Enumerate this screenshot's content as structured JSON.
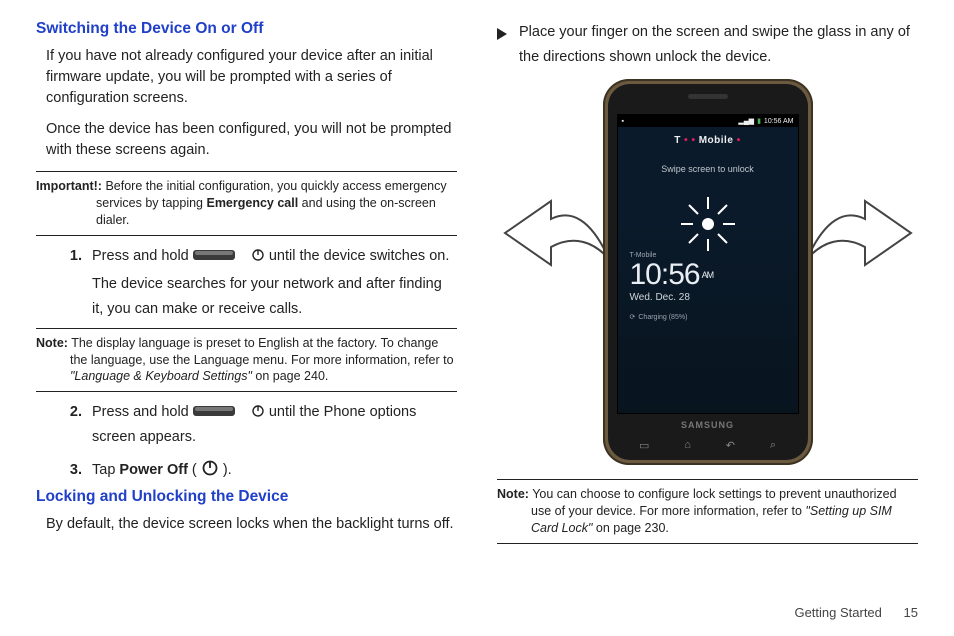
{
  "left": {
    "h1": "Switching the Device On or Off",
    "p1": "If you have not already configured your device after an initial firmware update, you will be prompted with a series of configuration screens.",
    "p2": "Once the device has been configured, you will not be prompted with these screens again.",
    "important_label": "Important!:",
    "important_text_a": "Before the initial configuration, you quickly access emergency services by tapping ",
    "important_bold": "Emergency call",
    "important_text_b": " and using the on-screen dialer.",
    "step1_num": "1.",
    "step1_a": "Press and hold ",
    "step1_b": " until the device switches on.",
    "step1_c": "The device searches for your network and after finding it, you can make or receive calls.",
    "note1_label": "Note:",
    "note1_a": "The display language is preset to English at the factory. To change the language, use the Language menu. For more information, refer to ",
    "note1_ref": "\"Language & Keyboard Settings\"",
    "note1_b": "  on page 240.",
    "step2_num": "2.",
    "step2_a": "Press and hold ",
    "step2_b": " until the Phone options screen appears.",
    "step3_num": "3.",
    "step3_a": "Tap ",
    "step3_bold": "Power Off",
    "step3_b": " ( ",
    "step3_c": " ).",
    "h2": "Locking and Unlocking the Device",
    "p3": "By default, the device screen locks when the backlight turns off."
  },
  "right": {
    "bullet": "Place your finger on the screen and swipe the glass in any of the directions shown unlock the device.",
    "phone": {
      "carrier": "T ·· Mobile",
      "status_time": "10:56 AM",
      "swipe": "Swipe screen to unlock",
      "clock_sub": "T-Mobile",
      "clock_time": "10:56",
      "clock_ampm": "AM",
      "clock_date": "Wed. Dec. 28",
      "charging": "Charging (85%)",
      "brand": "SAMSUNG"
    },
    "note_label": "Note:",
    "note_a": "You can choose to configure lock settings to prevent unauthorized use of your device. For more information, refer to ",
    "note_ref": "\"Setting up SIM Card Lock\"",
    "note_b": "  on page 230."
  },
  "footer": {
    "section": "Getting Started",
    "page": "15"
  }
}
